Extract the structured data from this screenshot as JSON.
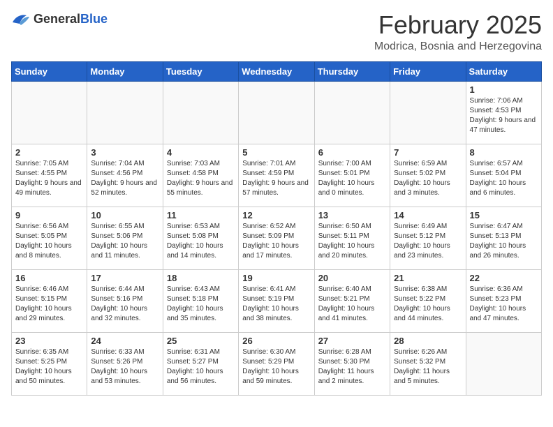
{
  "header": {
    "logo_general": "General",
    "logo_blue": "Blue",
    "month_title": "February 2025",
    "location": "Modrica, Bosnia and Herzegovina"
  },
  "weekdays": [
    "Sunday",
    "Monday",
    "Tuesday",
    "Wednesday",
    "Thursday",
    "Friday",
    "Saturday"
  ],
  "weeks": [
    [
      {
        "day": "",
        "empty": true
      },
      {
        "day": "",
        "empty": true
      },
      {
        "day": "",
        "empty": true
      },
      {
        "day": "",
        "empty": true
      },
      {
        "day": "",
        "empty": true
      },
      {
        "day": "",
        "empty": true
      },
      {
        "day": "1",
        "sunrise": "Sunrise: 7:06 AM",
        "sunset": "Sunset: 4:53 PM",
        "daylight": "Daylight: 9 hours and 47 minutes."
      }
    ],
    [
      {
        "day": "2",
        "sunrise": "Sunrise: 7:05 AM",
        "sunset": "Sunset: 4:55 PM",
        "daylight": "Daylight: 9 hours and 49 minutes."
      },
      {
        "day": "3",
        "sunrise": "Sunrise: 7:04 AM",
        "sunset": "Sunset: 4:56 PM",
        "daylight": "Daylight: 9 hours and 52 minutes."
      },
      {
        "day": "4",
        "sunrise": "Sunrise: 7:03 AM",
        "sunset": "Sunset: 4:58 PM",
        "daylight": "Daylight: 9 hours and 55 minutes."
      },
      {
        "day": "5",
        "sunrise": "Sunrise: 7:01 AM",
        "sunset": "Sunset: 4:59 PM",
        "daylight": "Daylight: 9 hours and 57 minutes."
      },
      {
        "day": "6",
        "sunrise": "Sunrise: 7:00 AM",
        "sunset": "Sunset: 5:01 PM",
        "daylight": "Daylight: 10 hours and 0 minutes."
      },
      {
        "day": "7",
        "sunrise": "Sunrise: 6:59 AM",
        "sunset": "Sunset: 5:02 PM",
        "daylight": "Daylight: 10 hours and 3 minutes."
      },
      {
        "day": "8",
        "sunrise": "Sunrise: 6:57 AM",
        "sunset": "Sunset: 5:04 PM",
        "daylight": "Daylight: 10 hours and 6 minutes."
      }
    ],
    [
      {
        "day": "9",
        "sunrise": "Sunrise: 6:56 AM",
        "sunset": "Sunset: 5:05 PM",
        "daylight": "Daylight: 10 hours and 8 minutes."
      },
      {
        "day": "10",
        "sunrise": "Sunrise: 6:55 AM",
        "sunset": "Sunset: 5:06 PM",
        "daylight": "Daylight: 10 hours and 11 minutes."
      },
      {
        "day": "11",
        "sunrise": "Sunrise: 6:53 AM",
        "sunset": "Sunset: 5:08 PM",
        "daylight": "Daylight: 10 hours and 14 minutes."
      },
      {
        "day": "12",
        "sunrise": "Sunrise: 6:52 AM",
        "sunset": "Sunset: 5:09 PM",
        "daylight": "Daylight: 10 hours and 17 minutes."
      },
      {
        "day": "13",
        "sunrise": "Sunrise: 6:50 AM",
        "sunset": "Sunset: 5:11 PM",
        "daylight": "Daylight: 10 hours and 20 minutes."
      },
      {
        "day": "14",
        "sunrise": "Sunrise: 6:49 AM",
        "sunset": "Sunset: 5:12 PM",
        "daylight": "Daylight: 10 hours and 23 minutes."
      },
      {
        "day": "15",
        "sunrise": "Sunrise: 6:47 AM",
        "sunset": "Sunset: 5:13 PM",
        "daylight": "Daylight: 10 hours and 26 minutes."
      }
    ],
    [
      {
        "day": "16",
        "sunrise": "Sunrise: 6:46 AM",
        "sunset": "Sunset: 5:15 PM",
        "daylight": "Daylight: 10 hours and 29 minutes."
      },
      {
        "day": "17",
        "sunrise": "Sunrise: 6:44 AM",
        "sunset": "Sunset: 5:16 PM",
        "daylight": "Daylight: 10 hours and 32 minutes."
      },
      {
        "day": "18",
        "sunrise": "Sunrise: 6:43 AM",
        "sunset": "Sunset: 5:18 PM",
        "daylight": "Daylight: 10 hours and 35 minutes."
      },
      {
        "day": "19",
        "sunrise": "Sunrise: 6:41 AM",
        "sunset": "Sunset: 5:19 PM",
        "daylight": "Daylight: 10 hours and 38 minutes."
      },
      {
        "day": "20",
        "sunrise": "Sunrise: 6:40 AM",
        "sunset": "Sunset: 5:21 PM",
        "daylight": "Daylight: 10 hours and 41 minutes."
      },
      {
        "day": "21",
        "sunrise": "Sunrise: 6:38 AM",
        "sunset": "Sunset: 5:22 PM",
        "daylight": "Daylight: 10 hours and 44 minutes."
      },
      {
        "day": "22",
        "sunrise": "Sunrise: 6:36 AM",
        "sunset": "Sunset: 5:23 PM",
        "daylight": "Daylight: 10 hours and 47 minutes."
      }
    ],
    [
      {
        "day": "23",
        "sunrise": "Sunrise: 6:35 AM",
        "sunset": "Sunset: 5:25 PM",
        "daylight": "Daylight: 10 hours and 50 minutes."
      },
      {
        "day": "24",
        "sunrise": "Sunrise: 6:33 AM",
        "sunset": "Sunset: 5:26 PM",
        "daylight": "Daylight: 10 hours and 53 minutes."
      },
      {
        "day": "25",
        "sunrise": "Sunrise: 6:31 AM",
        "sunset": "Sunset: 5:27 PM",
        "daylight": "Daylight: 10 hours and 56 minutes."
      },
      {
        "day": "26",
        "sunrise": "Sunrise: 6:30 AM",
        "sunset": "Sunset: 5:29 PM",
        "daylight": "Daylight: 10 hours and 59 minutes."
      },
      {
        "day": "27",
        "sunrise": "Sunrise: 6:28 AM",
        "sunset": "Sunset: 5:30 PM",
        "daylight": "Daylight: 11 hours and 2 minutes."
      },
      {
        "day": "28",
        "sunrise": "Sunrise: 6:26 AM",
        "sunset": "Sunset: 5:32 PM",
        "daylight": "Daylight: 11 hours and 5 minutes."
      },
      {
        "day": "",
        "empty": true
      }
    ]
  ]
}
